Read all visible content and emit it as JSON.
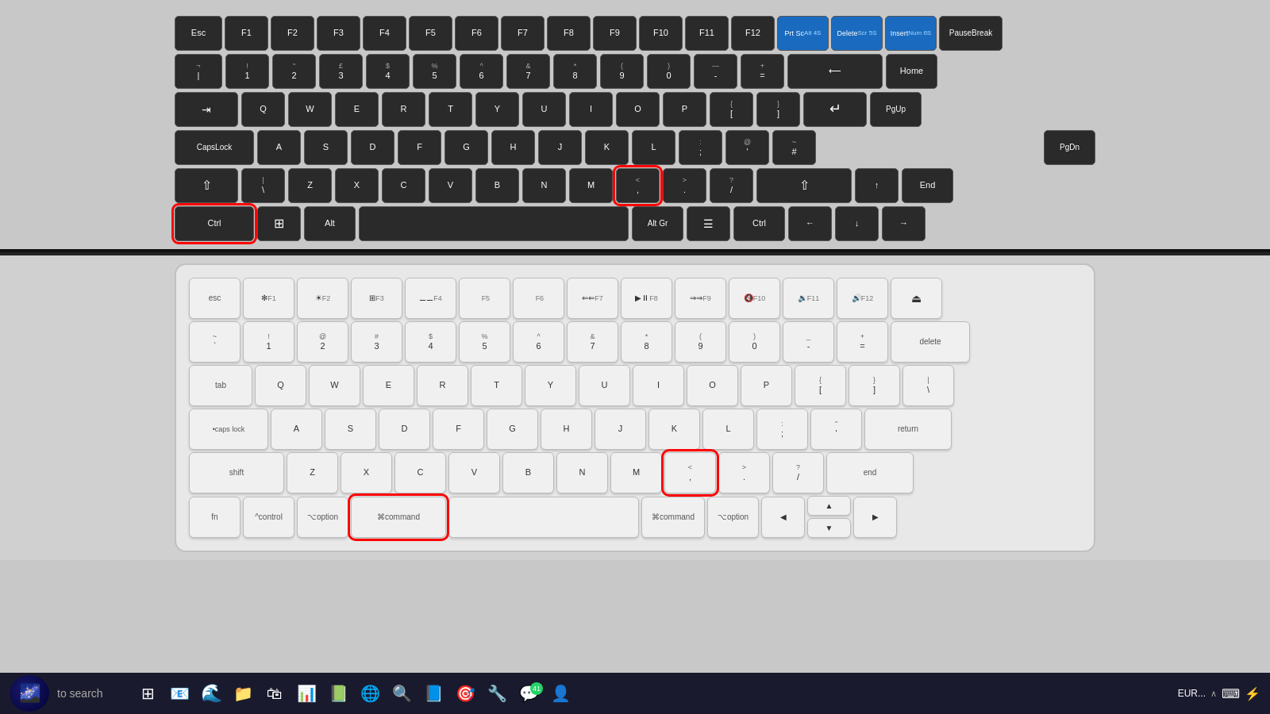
{
  "topKeyboard": {
    "rows": [
      [
        "Esc",
        "F1",
        "F2",
        "F3",
        "F4",
        "F5",
        "F6",
        "F7",
        "F8",
        "F9",
        "F10",
        "F11",
        "F12",
        "Prt Sc",
        "Delete",
        "Insert",
        "Pause Break"
      ],
      [
        "¬ |",
        "! 1",
        "\" 2",
        "£ 3",
        "$ 4",
        "% 5",
        "^ 6",
        "& 7",
        "* 8",
        "( 9",
        ") 0",
        "— -",
        "+ =",
        "←",
        "Home"
      ],
      [
        "Tab",
        "Q",
        "W",
        "E",
        "R",
        "T",
        "Y",
        "U",
        "I",
        "O",
        "P",
        "{ [",
        "} ]",
        "↵",
        "PgUp"
      ],
      [
        "Caps Lock",
        "A",
        "S",
        "D",
        "F",
        "G",
        "H",
        "J",
        "K",
        "L",
        ": ;",
        "@ '",
        "~ #",
        "PgDn"
      ],
      [
        "Shift",
        "| \\",
        "Z",
        "X",
        "C",
        "V",
        "B",
        "N",
        "M",
        "< ,",
        "> .",
        "? /",
        "Shift",
        "↑",
        "End"
      ],
      [
        "Ctrl",
        "⊞",
        "Alt",
        "[space]",
        "Alt Gr",
        "☰",
        "Ctrl",
        "←",
        "↓",
        "→"
      ]
    ]
  },
  "bottomKeyboard": {
    "rows": []
  },
  "taskbar": {
    "search_text": "to search",
    "icons": [
      "🌌",
      "⊞",
      "📧",
      "🌐",
      "📁",
      "🛍",
      "📊",
      "📗",
      "🌍",
      "📘",
      "🎯",
      "💬",
      "EUR..."
    ]
  }
}
